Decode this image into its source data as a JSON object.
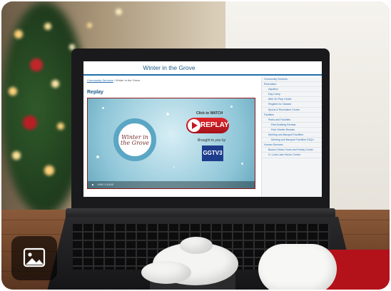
{
  "page": {
    "title": "Winter in the Grove",
    "breadcrumb": [
      "Community Services",
      "Winter in the Grove"
    ],
    "section_title": "Replay"
  },
  "video": {
    "wreath_text": "Winter in the Grove",
    "click_text": "Click to WATCH",
    "replay_label": "REPLAY",
    "brought_text": "Brought to you by",
    "logo_text": "GGTV3",
    "time_display": "0:00 / 1:10:10"
  },
  "sidebar": {
    "items": [
      {
        "label": "Community Services",
        "level": 1
      },
      {
        "label": "Recreation",
        "level": 1
      },
      {
        "label": "Aquatics",
        "level": 2
      },
      {
        "label": "Day Camp",
        "level": 2
      },
      {
        "label": "After-Ex Play Center",
        "level": 2
      },
      {
        "label": "Register for Classes",
        "level": 2
      },
      {
        "label": "Sports & Recreation Center",
        "level": 2
      },
      {
        "label": "Facilities",
        "level": 1
      },
      {
        "label": "Parks and Facilities",
        "level": 2
      },
      {
        "label": "Park Building Rentals",
        "level": 3
      },
      {
        "label": "Park Shelter Rentals",
        "level": 3
      },
      {
        "label": "Meeting and Banquet Facilities",
        "level": 2
      },
      {
        "label": "Meeting and Banquet Facilities FAQ's",
        "level": 3
      },
      {
        "label": "Human Services",
        "level": 1
      },
      {
        "label": "Buena Clinton Youth and Family Center",
        "level": 2
      },
      {
        "label": "H. Louis Lake Senior Center",
        "level": 2
      }
    ]
  },
  "overlay": {
    "icon": "image-icon"
  },
  "colors": {
    "accent": "#1e6fa8",
    "replay_red": "#c41a22",
    "sleeve_red": "#b3121a"
  }
}
